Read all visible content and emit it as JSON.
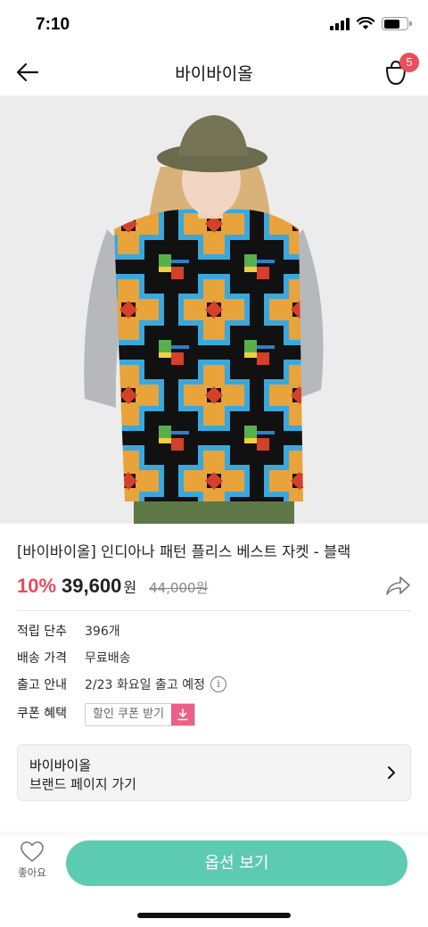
{
  "status_bar": {
    "time": "7:10"
  },
  "nav": {
    "title": "바이바이올",
    "cart_count": "5"
  },
  "product": {
    "title": "[바이바이올] 인디아나 패턴 플리스 베스트 자켓 - 블랙",
    "discount": "10%",
    "price": "39,600",
    "currency": "원",
    "original_price": "44,000원"
  },
  "info": {
    "points": {
      "label": "적립 단추",
      "value": "396개"
    },
    "shipping": {
      "label": "배송 가격",
      "value": "무료배송"
    },
    "release": {
      "label": "출고 안내",
      "value": "2/23 화요일 출고 예정"
    },
    "coupon": {
      "label": "쿠폰 혜택",
      "button": "할인 쿠폰 받기"
    }
  },
  "brand_card": {
    "name": "바이바이올",
    "link": "브랜드 페이지 가기"
  },
  "bottom": {
    "like_label": "좋아요",
    "options_button": "옵션 보기"
  },
  "colors": {
    "accent": "#5ccbb2",
    "discount": "#e84a5f",
    "badge": "#ef4c5c",
    "coupon": "#ec5f87"
  },
  "icons": [
    "back-arrow-icon",
    "cart-bag-icon",
    "share-icon",
    "info-icon",
    "download-icon",
    "chevron-right-icon",
    "heart-icon"
  ]
}
